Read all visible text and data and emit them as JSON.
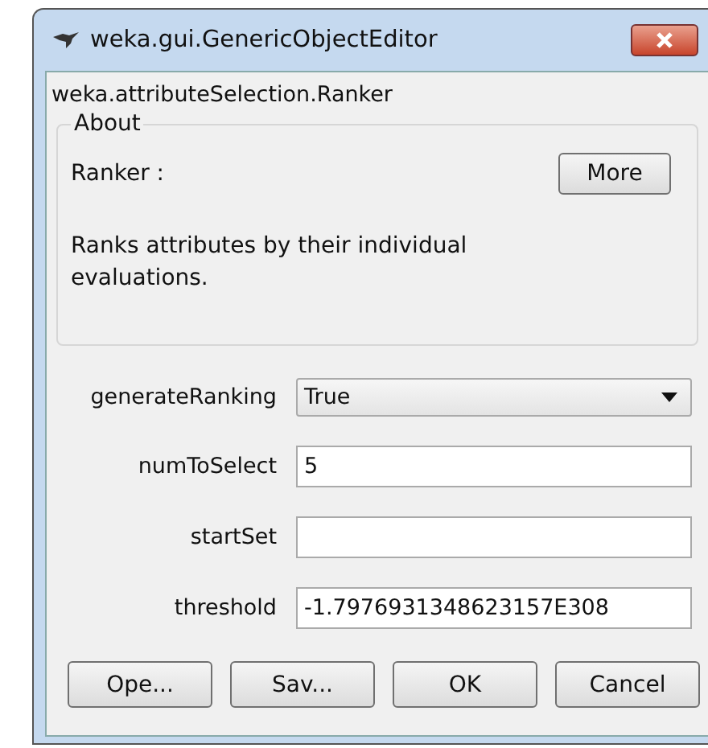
{
  "window": {
    "title": "weka.gui.GenericObjectEditor"
  },
  "class_name": "weka.attributeSelection.Ranker",
  "about": {
    "title": "About",
    "heading": "Ranker :",
    "more_button": "More",
    "description": "Ranks attributes by their individual evaluations."
  },
  "properties": [
    {
      "label": "generateRanking",
      "kind": "dropdown",
      "value": "True"
    },
    {
      "label": "numToSelect",
      "kind": "text",
      "value": "5"
    },
    {
      "label": "startSet",
      "kind": "text"
    },
    {
      "label": "threshold",
      "kind": "text",
      "value": "-1.7976931348623157E308"
    }
  ],
  "buttons": [
    "Ope...",
    "Sav...",
    "OK",
    "Cancel"
  ]
}
